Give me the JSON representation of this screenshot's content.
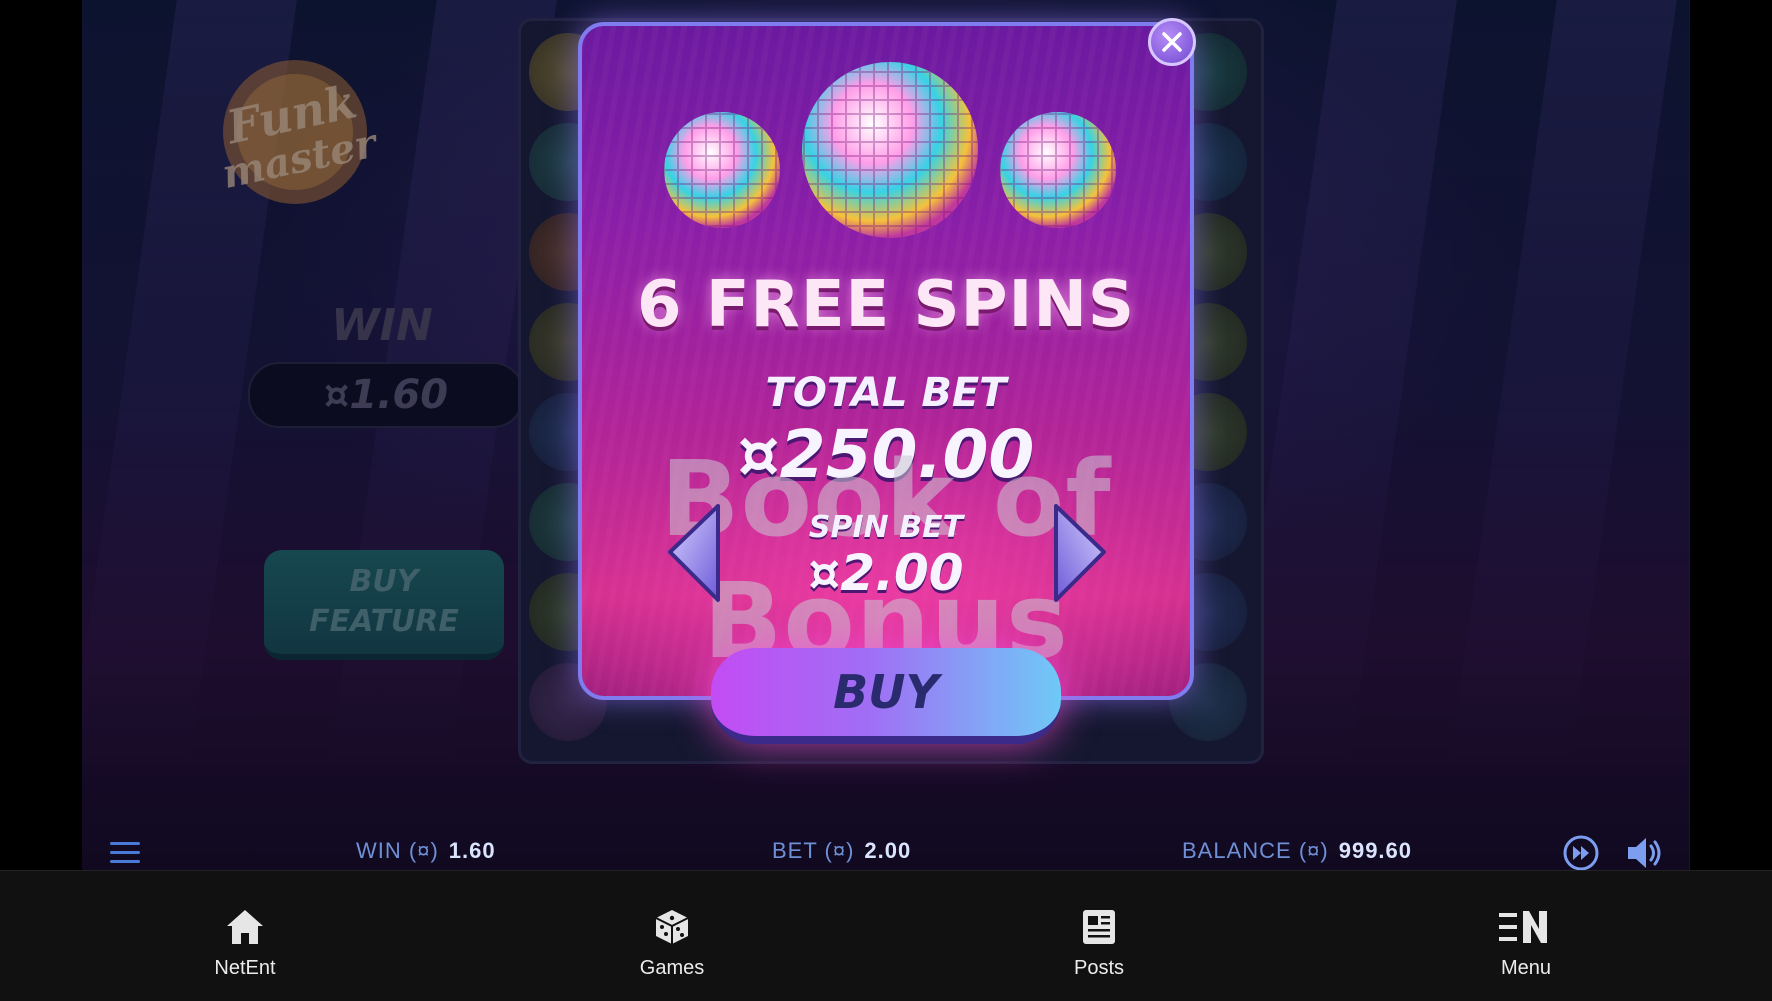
{
  "game": {
    "logo_text": "Funk master",
    "win_title": "WIN",
    "win_amount": "¤1.60",
    "buy_feature_label": "BUY\nFEATURE"
  },
  "popup": {
    "free_spins_title": "6 FREE SPINS",
    "total_bet_label": "TOTAL BET",
    "total_bet_value": "¤250.00",
    "spin_bet_label": "SPIN BET",
    "spin_bet_value": "¤2.00",
    "buy_label": "BUY"
  },
  "watermark": "Book of Bonus",
  "status_bar": {
    "win_label": "WIN (¤)",
    "win_value": "1.60",
    "bet_label": "BET (¤)",
    "bet_value": "2.00",
    "balance_label": "BALANCE (¤)",
    "balance_value": "999.60"
  },
  "app_nav": [
    {
      "label": "NetEnt",
      "icon": "home-icon"
    },
    {
      "label": "Games",
      "icon": "dice-icon"
    },
    {
      "label": "Posts",
      "icon": "newspaper-icon"
    },
    {
      "label": "Menu",
      "icon": "menu-brand-icon"
    }
  ],
  "colors": {
    "popup_border": "#7f7cf0",
    "popup_top": "#6a1aa0",
    "popup_bottom": "#d4308f",
    "status_label": "#6f8fd6",
    "nav_background": "#111111"
  }
}
